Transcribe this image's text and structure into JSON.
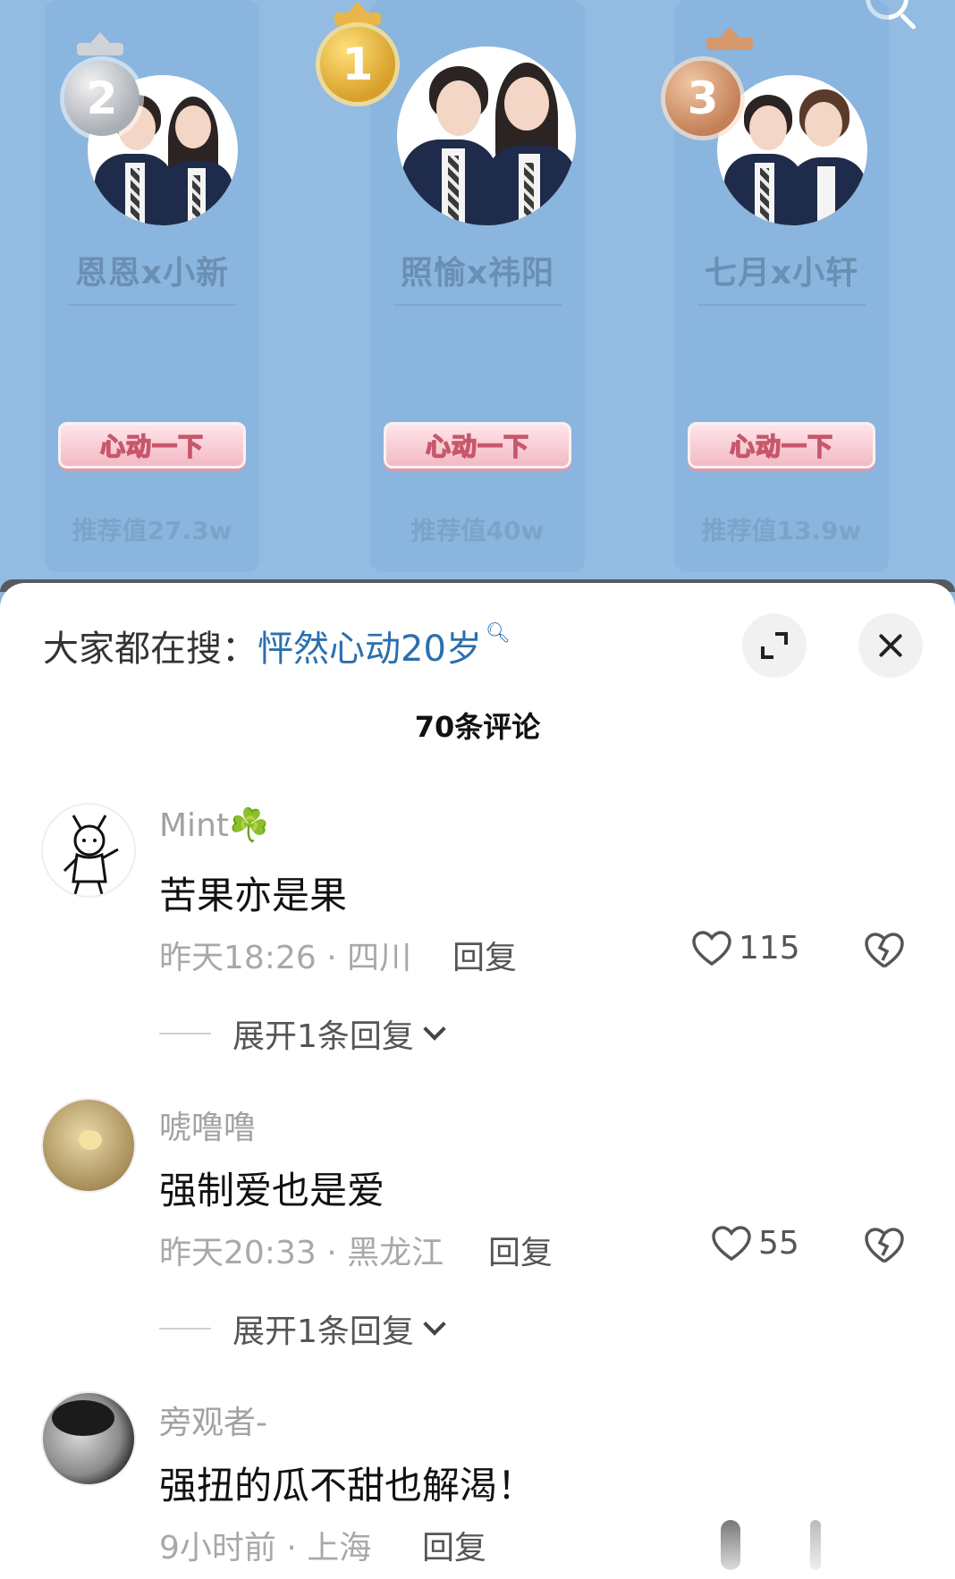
{
  "ranking": {
    "entries": [
      {
        "rank": "2",
        "pair": "恩恩x小新",
        "button": "心动一下",
        "score": "推荐值27.3w"
      },
      {
        "rank": "1",
        "pair": "照愉x祎阳",
        "button": "心动一下",
        "score": "推荐值40w"
      },
      {
        "rank": "3",
        "pair": "七月x小轩",
        "button": "心动一下",
        "score": "推荐值13.9w"
      }
    ],
    "colors": {
      "panel": "#94bce2",
      "pair_name": "#6b8fb3",
      "button_fill": "#f3b9c4"
    }
  },
  "sheet": {
    "hot_search_label": "大家都在搜：",
    "hot_search_term": "怦然心动20岁",
    "comment_count": "70条评论",
    "colors": {
      "hot_term": "#2a6fae",
      "meta": "#a8a8a8"
    }
  },
  "comments": [
    {
      "user": "Mint☘️",
      "text": "苦果亦是果",
      "meta": "昨天18:26 · 四川",
      "reply": "回复",
      "likes": "115",
      "expand": "展开1条回复"
    },
    {
      "user": "唬噜噜",
      "text": "强制爱也是爱",
      "meta": "昨天20:33 · 黑龙江",
      "reply": "回复",
      "likes": "55",
      "expand": "展开1条回复"
    },
    {
      "user": "旁观者-",
      "text": "强扭的瓜不甜也解渴！",
      "meta": "9小时前 · 上海",
      "reply": "回复"
    }
  ],
  "icons": [
    "search-icon",
    "expand-icon",
    "close-icon",
    "heart-outline-icon",
    "broken-heart-icon",
    "chevron-down-icon",
    "clover-icon"
  ]
}
